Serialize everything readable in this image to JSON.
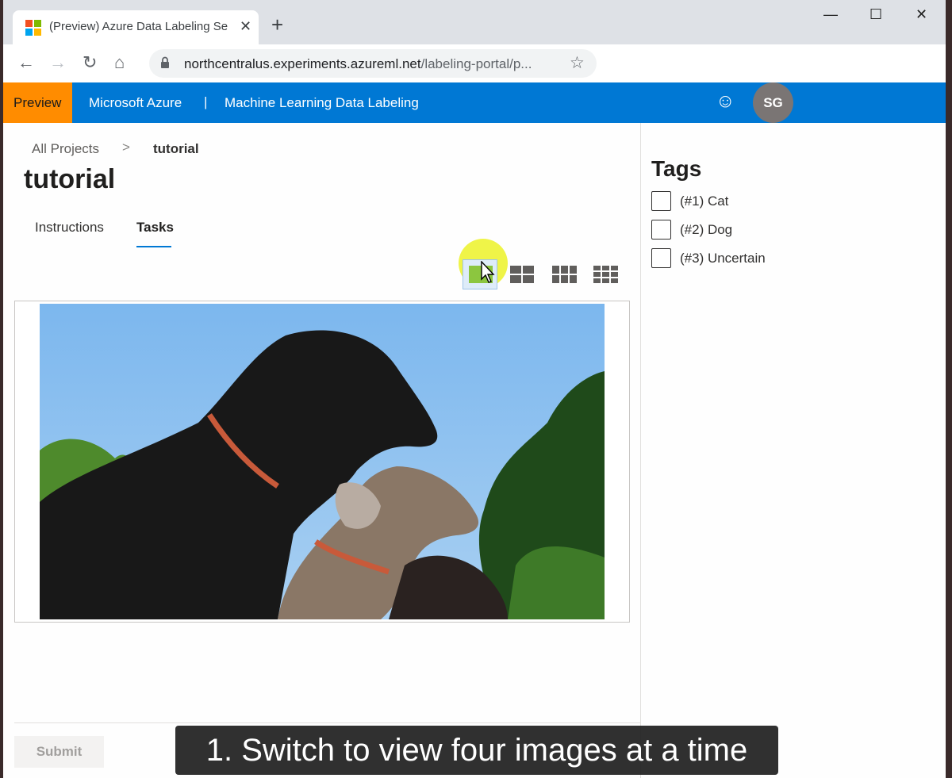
{
  "browser": {
    "tab_title": "(Preview) Azure Data Labeling Se",
    "tab_close": "✕",
    "new_tab": "+",
    "url_host": "northcentralus.experiments.azureml.net",
    "url_path": "/labeling-portal/p...",
    "minimize": "—",
    "maximize": "☐",
    "close": "✕",
    "back": "←",
    "forward": "→",
    "reload": "↻",
    "home": "⌂",
    "star": "☆"
  },
  "header": {
    "preview": "Preview",
    "brand": "Microsoft Azure",
    "separator": "|",
    "product": "Machine Learning Data Labeling",
    "feedback_icon": "☺",
    "avatar_initials": "SG",
    "color": "#0078d4",
    "preview_color": "#ff8c00"
  },
  "breadcrumb": {
    "root": "All Projects",
    "chevron": ">",
    "current": "tutorial"
  },
  "page": {
    "title": "tutorial",
    "tabs": [
      {
        "label": "Instructions",
        "active": false
      },
      {
        "label": "Tasks",
        "active": true
      }
    ]
  },
  "view_options": [
    {
      "icon": "grid-1-icon",
      "active": true
    },
    {
      "icon": "grid-4-icon",
      "active": false
    },
    {
      "icon": "grid-6-icon",
      "active": false
    },
    {
      "icon": "grid-9-icon",
      "active": false
    }
  ],
  "tags": {
    "title": "Tags",
    "items": [
      {
        "label": "(#1) Cat",
        "checked": false
      },
      {
        "label": "(#2) Dog",
        "checked": false
      },
      {
        "label": "(#3) Uncertain",
        "checked": false
      }
    ]
  },
  "actions": {
    "submit": "Submit"
  },
  "caption": "1. Switch to view four images at a time"
}
